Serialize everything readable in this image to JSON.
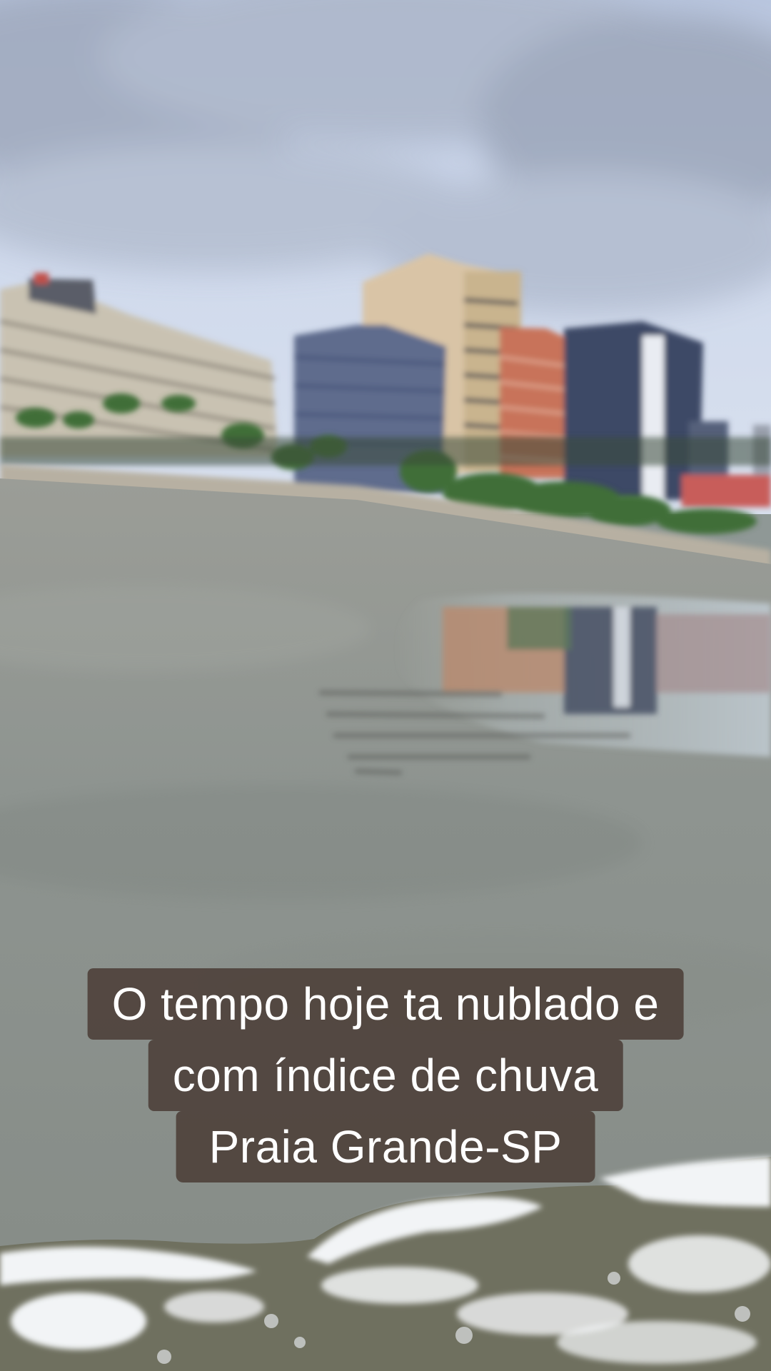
{
  "caption": {
    "lines": [
      "O tempo hoje ta nublado e",
      "com índice de chuva",
      "Praia Grande-SP"
    ]
  },
  "colors": {
    "sky": "#c7d2e6",
    "clouds": "#9aa4b8",
    "sand_wet": "#8e948f",
    "water_foam": "#f2f4f6",
    "caption_background": "#4a3c36",
    "caption_text": "#ffffff"
  }
}
